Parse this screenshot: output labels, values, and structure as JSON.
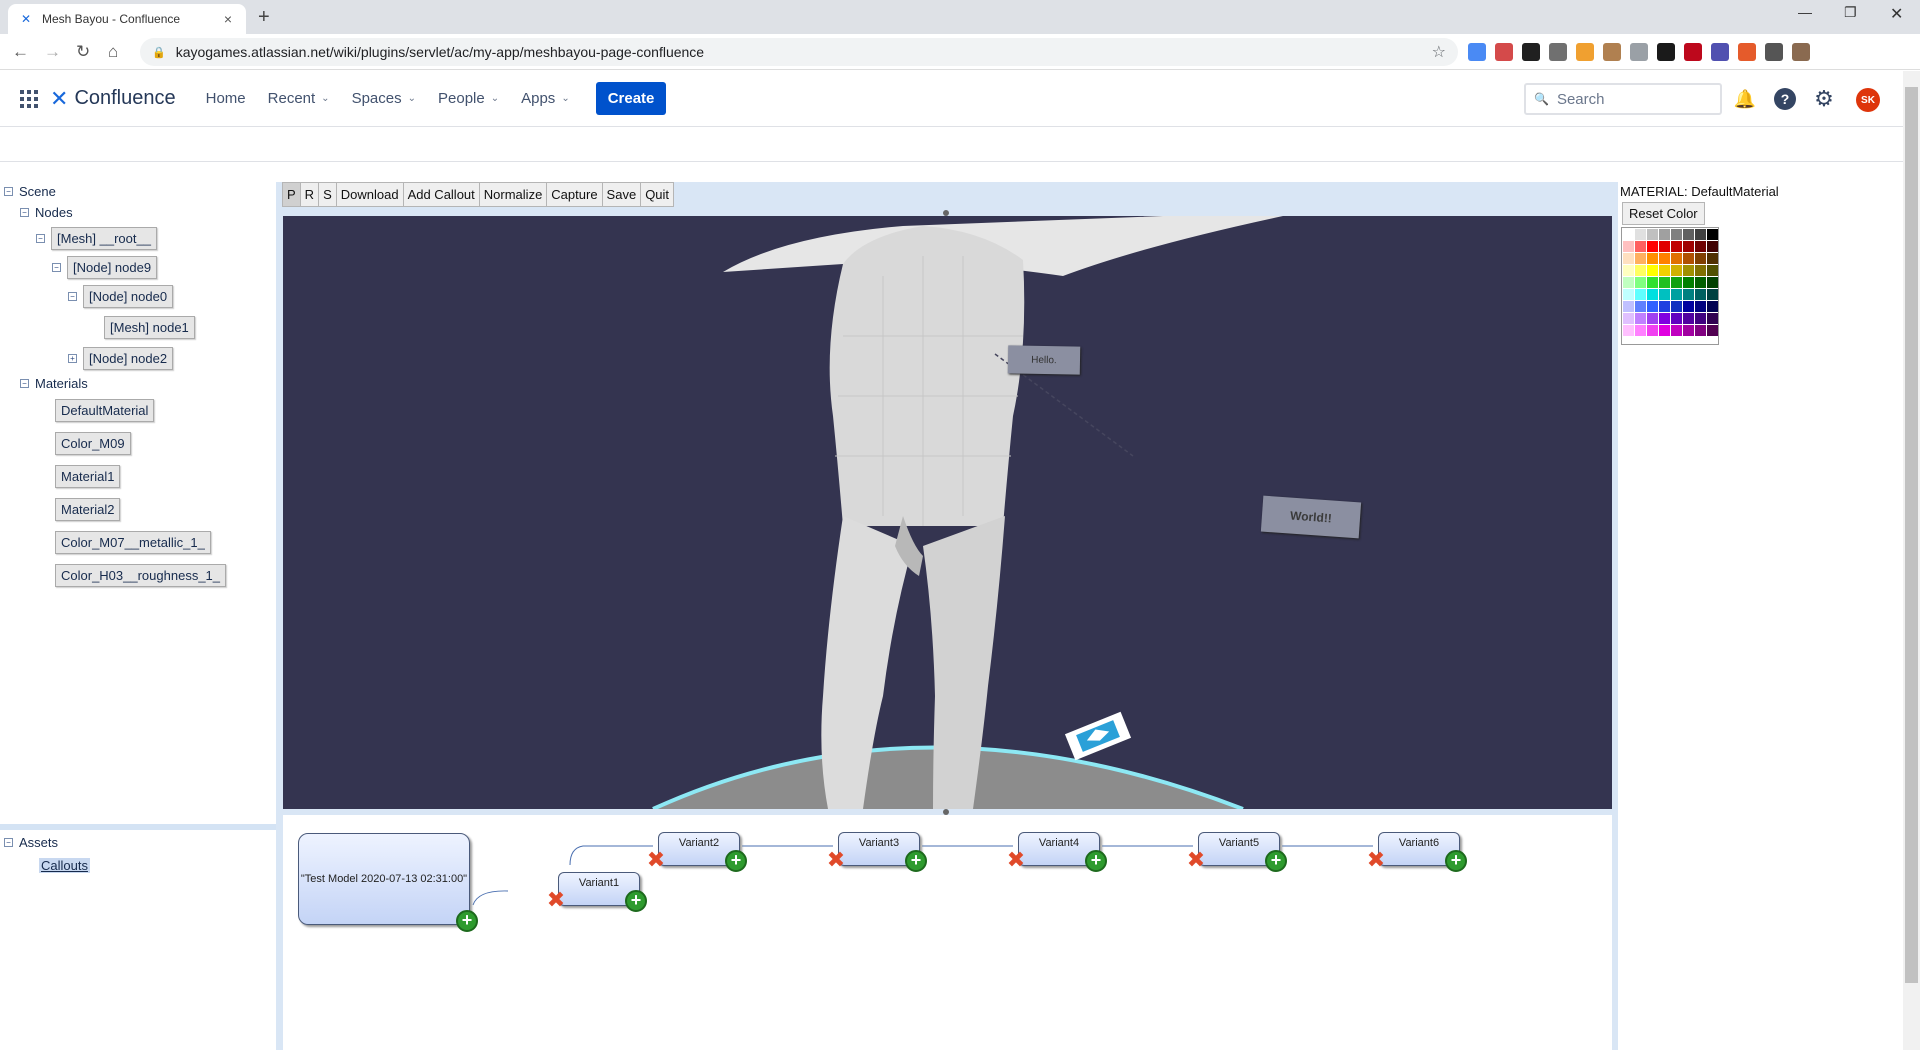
{
  "browser": {
    "tab_title": "Mesh Bayou - Confluence",
    "url": "kayogames.atlassian.net/wiki/plugins/servlet/ac/my-app/meshbayou-page-confluence",
    "extensions": [
      "#4a8af4",
      "#d44a4a",
      "#202020",
      "#707070",
      "#f0a030",
      "#b08050",
      "#9aa0a6",
      "#1a1a1a",
      "#bd081c",
      "#5050b0",
      "#e55b2b",
      "#555555",
      "#8a6a50"
    ]
  },
  "header": {
    "product": "Confluence",
    "nav": [
      "Home",
      "Recent",
      "Spaces",
      "People",
      "Apps"
    ],
    "create_label": "Create",
    "search_placeholder": "Search",
    "avatar_initials": "SK",
    "help_glyph": "?"
  },
  "tree": {
    "scene_label": "Scene",
    "nodes_label": "Nodes",
    "node_items": [
      "[Mesh] __root__",
      "[Node] node9",
      "[Node] node0",
      "[Mesh] node1",
      "[Node] node2"
    ],
    "materials_label": "Materials",
    "material_items": [
      "DefaultMaterial",
      "Color_M09",
      "Material1",
      "Material2",
      "Color_M07__metallic_1_",
      "Color_H03__roughness_1_"
    ],
    "assets_label": "Assets",
    "callouts_label": "Callouts"
  },
  "toolbar": [
    "P",
    "R",
    "S",
    "Download",
    "Add Callout",
    "Normalize",
    "Capture",
    "Save",
    "Quit"
  ],
  "viewport": {
    "callout1": "Hello.",
    "callout2": "World!!"
  },
  "graph": {
    "root_label": "\"Test Model 2020-07-13 02:31:00\"",
    "variants": [
      "Variant1",
      "Variant2",
      "Variant3",
      "Variant4",
      "Variant5",
      "Variant6"
    ]
  },
  "material_panel": {
    "title": "MATERIAL: DefaultMaterial",
    "reset_label": "Reset Color",
    "palette": [
      "#ffffff",
      "#e0e0e0",
      "#c0c0c0",
      "#a0a0a0",
      "#808080",
      "#606060",
      "#404040",
      "#000000",
      "#ffc0c0",
      "#ff6060",
      "#ff0000",
      "#e00000",
      "#c00000",
      "#a00000",
      "#700000",
      "#400000",
      "#ffe0c0",
      "#ffb060",
      "#ff9000",
      "#ff8000",
      "#e07000",
      "#b05000",
      "#804000",
      "#503000",
      "#ffffc0",
      "#ffff60",
      "#ffff00",
      "#f0d000",
      "#d0b000",
      "#a09000",
      "#807000",
      "#505000",
      "#c0ffc0",
      "#80ff80",
      "#30e030",
      "#20c020",
      "#10a010",
      "#008000",
      "#006000",
      "#004000",
      "#c0ffff",
      "#60ffff",
      "#00e0e0",
      "#00c0c0",
      "#00a0a0",
      "#008080",
      "#006060",
      "#004040",
      "#c0c0ff",
      "#6080ff",
      "#3060ff",
      "#2040e0",
      "#1030c0",
      "#0000a0",
      "#000080",
      "#000050",
      "#e0c0ff",
      "#c080ff",
      "#a040f0",
      "#8000e0",
      "#6000c0",
      "#5000a0",
      "#400080",
      "#300050",
      "#ffc0ff",
      "#ff80ff",
      "#f040f0",
      "#e000e0",
      "#c000c0",
      "#a000a0",
      "#800080",
      "#500050"
    ]
  }
}
